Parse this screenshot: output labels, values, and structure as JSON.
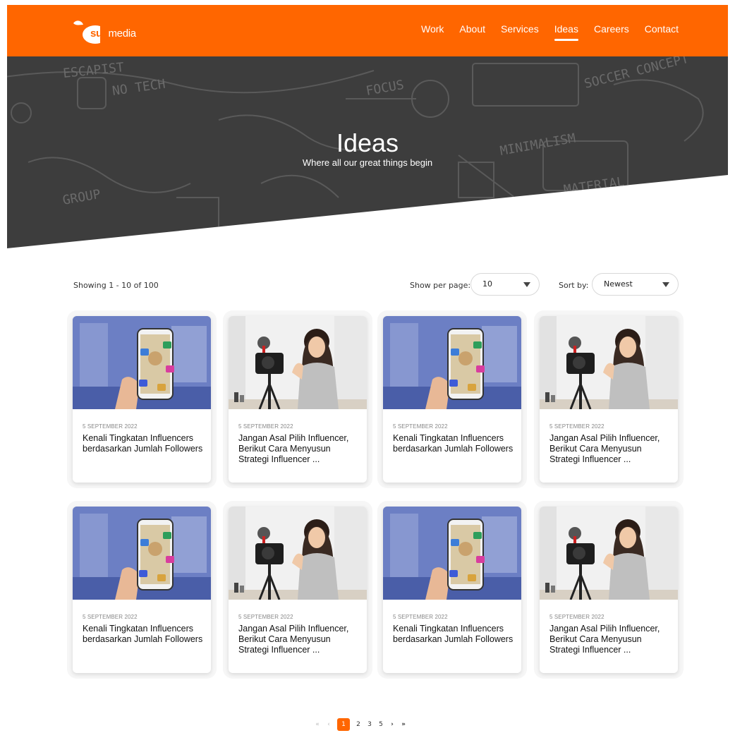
{
  "brand": {
    "logo_text_bold": "suit",
    "logo_text": "media",
    "accent": "#ff6600"
  },
  "nav": [
    {
      "label": "Work",
      "active": false
    },
    {
      "label": "About",
      "active": false
    },
    {
      "label": "Services",
      "active": false
    },
    {
      "label": "Ideas",
      "active": true
    },
    {
      "label": "Careers",
      "active": false
    },
    {
      "label": "Contact",
      "active": false
    }
  ],
  "hero": {
    "title": "Ideas",
    "subtitle": "Where all our great things begin",
    "sketch_words": [
      "ESCAPIST",
      "NO TECH",
      "FOCUS",
      "SOCCER CONCEPT",
      "MINIMALISM",
      "MATERIAL",
      "GROUP"
    ]
  },
  "toolbar": {
    "showing": "Showing 1 - 10 of 100",
    "per_page_label": "Show per page:",
    "per_page_value": "10",
    "sort_label": "Sort by:",
    "sort_value": "Newest"
  },
  "cards": [
    {
      "image": "phone-social-media",
      "date": "5 SEPTEMBER 2022",
      "title": "Kenali Tingkatan Influencers berdasarkan Jumlah Followers"
    },
    {
      "image": "woman-vlogging",
      "date": "5 SEPTEMBER 2022",
      "title": "Jangan Asal Pilih Influencer, Berikut Cara Menyusun Strategi Influencer ..."
    },
    {
      "image": "phone-social-media",
      "date": "5 SEPTEMBER 2022",
      "title": "Kenali Tingkatan Influencers berdasarkan Jumlah Followers"
    },
    {
      "image": "woman-vlogging",
      "date": "5 SEPTEMBER 2022",
      "title": "Jangan Asal Pilih Influencer, Berikut Cara Menyusun Strategi Influencer ..."
    },
    {
      "image": "phone-social-media",
      "date": "5 SEPTEMBER 2022",
      "title": "Kenali Tingkatan Influencers berdasarkan Jumlah Followers"
    },
    {
      "image": "woman-vlogging",
      "date": "5 SEPTEMBER 2022",
      "title": "Jangan Asal Pilih Influencer, Berikut Cara Menyusun Strategi Influencer ..."
    },
    {
      "image": "phone-social-media",
      "date": "5 SEPTEMBER 2022",
      "title": "Kenali Tingkatan Influencers berdasarkan Jumlah Followers"
    },
    {
      "image": "woman-vlogging",
      "date": "5 SEPTEMBER 2022",
      "title": "Jangan Asal Pilih Influencer, Berikut Cara Menyusun Strategi Influencer ..."
    }
  ],
  "pagination": {
    "first": "«",
    "prev": "‹",
    "pages": [
      "1",
      "2",
      "3",
      "5"
    ],
    "current": "1",
    "next": "›",
    "last": "»"
  }
}
